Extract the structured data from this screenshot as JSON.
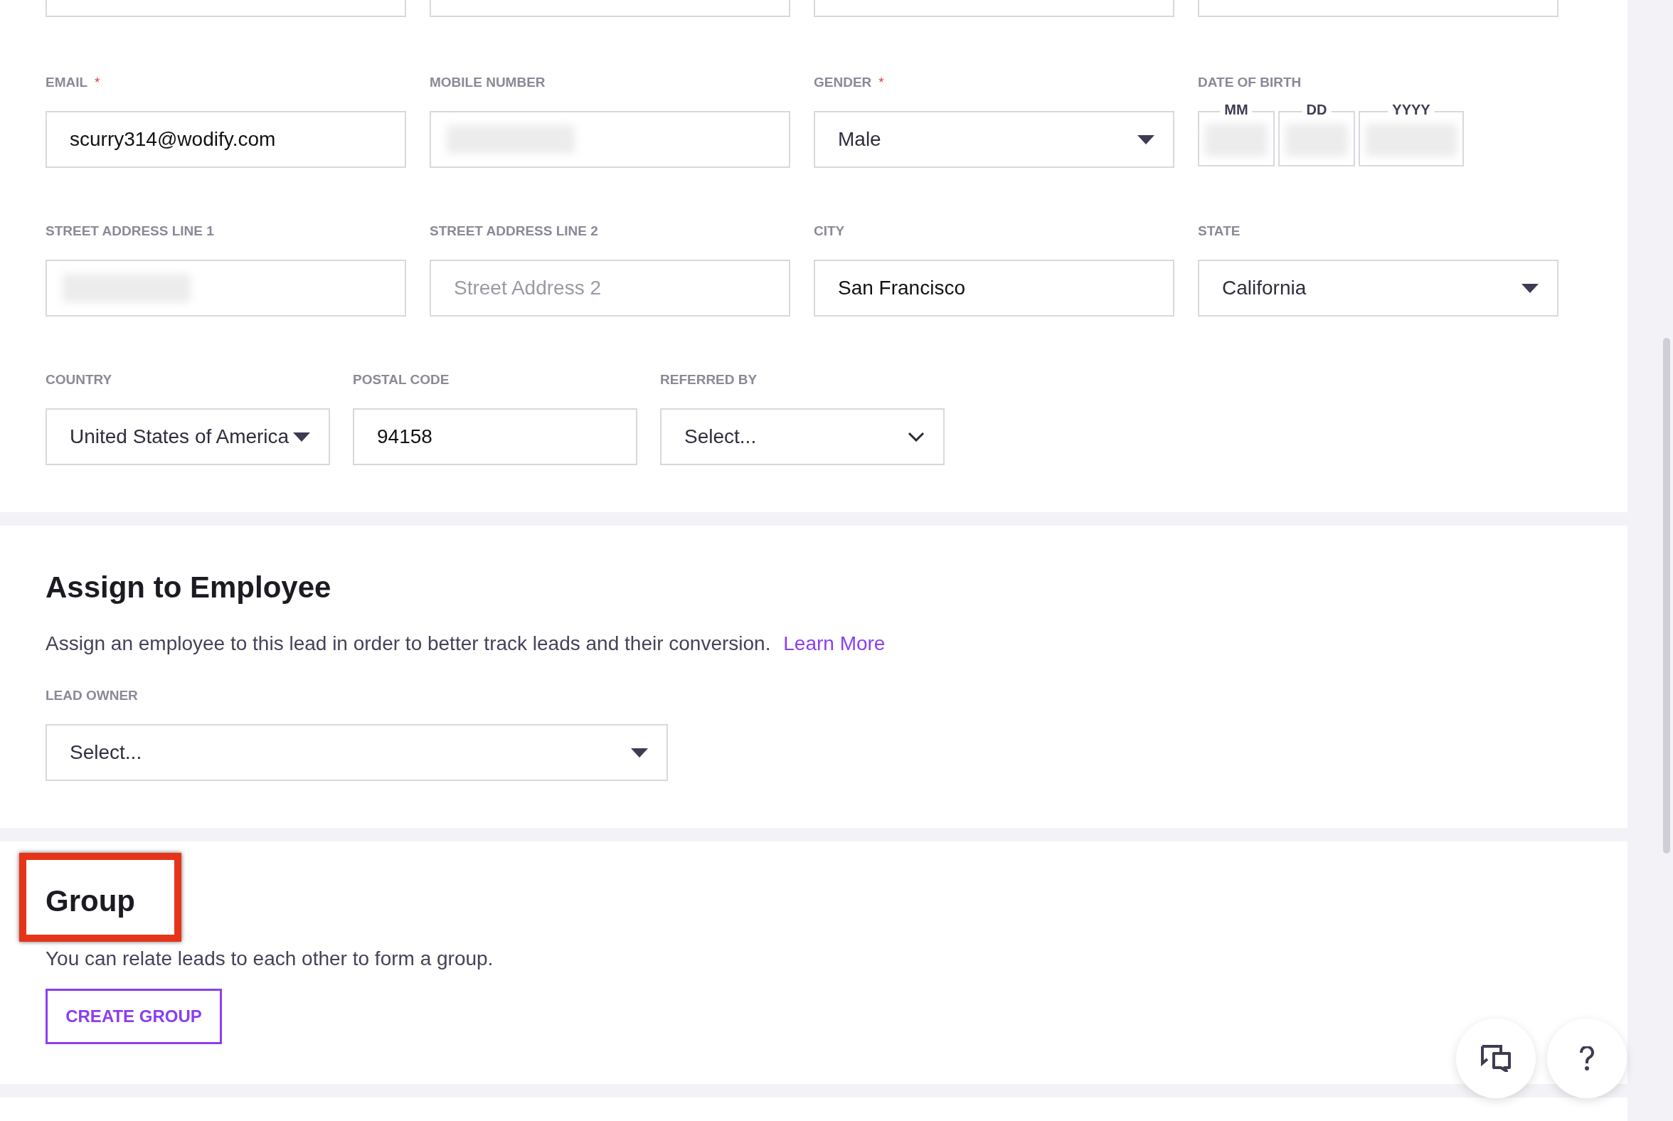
{
  "contact_form": {
    "rows": [
      [
        {
          "label": "EMAIL",
          "required_mark": "*",
          "kind": "text",
          "value": "scurry314@wodify.com"
        },
        {
          "label": "MOBILE NUMBER",
          "kind": "text",
          "redacted": true
        },
        {
          "label": "GENDER",
          "required_mark": "*",
          "kind": "select",
          "value": "Male"
        },
        {
          "label": "DATE OF BIRTH",
          "kind": "date",
          "parts": [
            "MM",
            "DD",
            "YYYY"
          ],
          "redacted": true
        }
      ],
      [
        {
          "label": "STREET ADDRESS LINE 1",
          "kind": "text",
          "redacted": true
        },
        {
          "label": "STREET ADDRESS LINE 2",
          "kind": "text",
          "placeholder": "Street Address 2"
        },
        {
          "label": "CITY",
          "kind": "text",
          "value": "San Francisco"
        },
        {
          "label": "STATE",
          "kind": "select",
          "value": "California"
        }
      ],
      [
        {
          "label": "COUNTRY",
          "kind": "select",
          "value": "United States of America"
        },
        {
          "label": "POSTAL CODE",
          "kind": "text",
          "value": "94158"
        },
        {
          "label": "REFERRED BY",
          "kind": "combo",
          "value": "Select..."
        }
      ]
    ]
  },
  "assign_to_employee": {
    "heading": "Assign to Employee",
    "description": "Assign an employee to this lead in order to better track leads and their conversion.",
    "link": "Learn More",
    "lead_owner": {
      "label": "LEAD OWNER",
      "kind": "select",
      "value": "Select..."
    }
  },
  "group": {
    "heading": "Group",
    "highlighted": true,
    "description": "You can relate leads to each other to form a group.",
    "button": "CREATE GROUP"
  },
  "floating_buttons": [
    {
      "kind": "chat"
    },
    {
      "kind": "help"
    }
  ]
}
